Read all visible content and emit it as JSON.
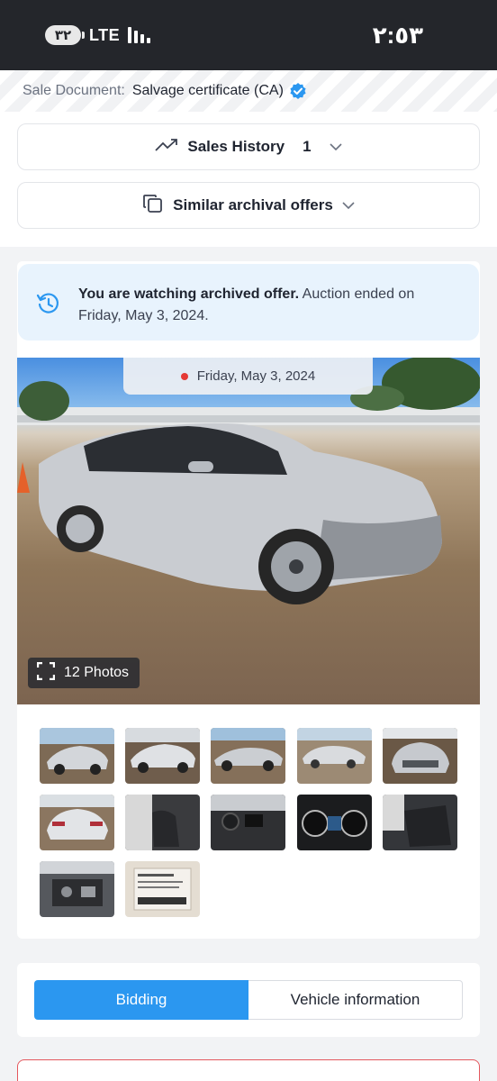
{
  "status_bar": {
    "battery": "٣٢",
    "network": "LTE",
    "time": "٢:٥٣"
  },
  "sale_document": {
    "label": "Sale Document:",
    "value": "Salvage certificate (CA)"
  },
  "accordions": {
    "sales_history": {
      "label": "Sales History",
      "count": "1"
    },
    "similar_offers": {
      "label": "Similar archival offers"
    }
  },
  "archive_notice": {
    "bold": "You are watching archived offer.",
    "text": " Auction ended on Friday, May 3, 2024."
  },
  "gallery": {
    "date": "Friday, May 3, 2024",
    "photos_count": "12 Photos",
    "thumbnails": [
      "front-left",
      "front-left-2",
      "side-left",
      "front-right",
      "front-damage",
      "rear",
      "front-seats",
      "dashboard",
      "instrument-cluster",
      "rear-seats",
      "engine-bay",
      "vin-label"
    ]
  },
  "tabs": {
    "bidding": "Bidding",
    "vehicle_info": "Vehicle information"
  },
  "colors": {
    "accent": "#2b97f0",
    "banner_bg": "#e8f3fd",
    "status_bar": "#24262b",
    "alert_border": "#e4575d"
  }
}
